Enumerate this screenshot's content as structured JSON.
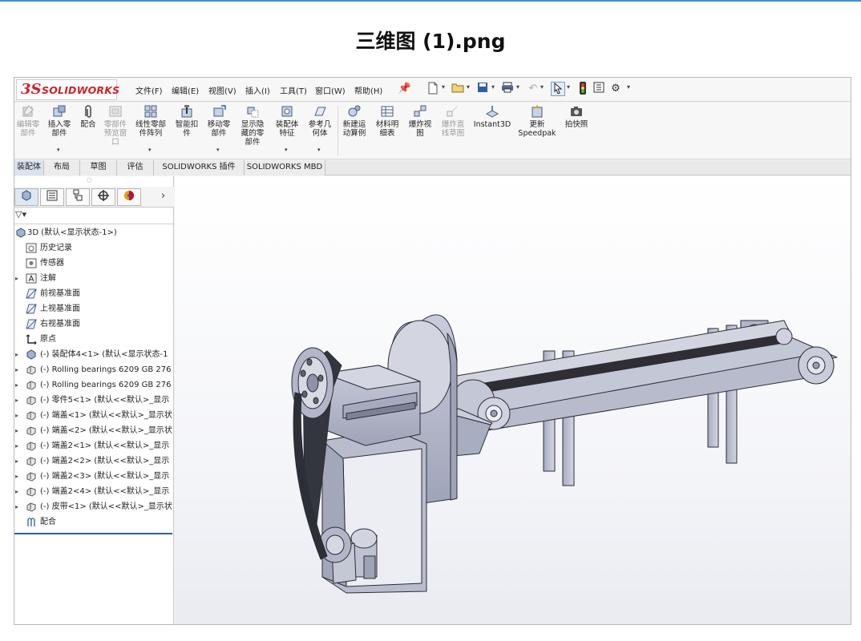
{
  "page": {
    "title": "三维图 (1).png"
  },
  "app": {
    "logo": {
      "mark": "3S",
      "text": "SOLIDWORKS"
    },
    "menu": [
      "文件(F)",
      "编辑(E)",
      "视图(V)",
      "插入(I)",
      "工具(T)",
      "窗口(W)",
      "帮助(H)"
    ],
    "quick_access_icons": [
      "pin-icon",
      "new-document-icon",
      "open-folder-icon",
      "save-icon",
      "print-icon",
      "undo-icon",
      "select-arrow-icon",
      "rebuild-traffic-light-icon",
      "file-properties-icon",
      "options-gear-icon"
    ]
  },
  "ribbon": {
    "edit_component": "编辑零\n部件",
    "insert_component": "插入零\n部件",
    "mate": "配合",
    "component_preview": "零部件\n预览窗\n口",
    "linear_pattern": "线性零部\n件阵列",
    "smart_fasteners": "智能扣\n件",
    "move_component": "移动零\n部件",
    "show_hidden": "显示隐\n藏的零\n部件",
    "assembly_features": "装配体\n特征",
    "reference_geometry": "参考几\n何体",
    "new_motion_study": "新建运\n动算例",
    "bill_of_materials": "材料明\n细表",
    "exploded_view": "爆炸视\n图",
    "explode_line": "爆炸直\n线草图",
    "instant3d": "Instant3D",
    "update_speedpak": "更新\nSpeedpak",
    "take_snapshot": "拍快照"
  },
  "tabs": [
    "装配体",
    "布局",
    "草图",
    "评估",
    "SOLIDWORKS 插件",
    "SOLIDWORKS MBD"
  ],
  "feature_tree": {
    "root": "3D  (默认<显示状态-1>)",
    "items": [
      {
        "label": "历史记录",
        "expandable": false,
        "icon": "history-icon"
      },
      {
        "label": "传感器",
        "expandable": false,
        "icon": "sensor-icon"
      },
      {
        "label": "注解",
        "expandable": true,
        "icon": "annotation-icon"
      },
      {
        "label": "前视基准面",
        "expandable": false,
        "icon": "plane-icon"
      },
      {
        "label": "上视基准面",
        "expandable": false,
        "icon": "plane-icon"
      },
      {
        "label": "右视基准面",
        "expandable": false,
        "icon": "plane-icon"
      },
      {
        "label": "原点",
        "expandable": false,
        "icon": "origin-icon"
      },
      {
        "label": "(-) 装配体4<1> (默认<显示状态-1",
        "expandable": true,
        "icon": "subassembly-icon"
      },
      {
        "label": "(-) Rolling bearings 6209 GB 276",
        "expandable": true,
        "icon": "part-icon"
      },
      {
        "label": "(-) Rolling bearings 6209 GB 276",
        "expandable": true,
        "icon": "part-icon"
      },
      {
        "label": "(-) 零件5<1> (默认<<默认>_显示",
        "expandable": true,
        "icon": "part-icon"
      },
      {
        "label": "(-) 端盖<1> (默认<<默认>_显示状",
        "expandable": true,
        "icon": "part-icon"
      },
      {
        "label": "(-) 端盖<2> (默认<<默认>_显示状",
        "expandable": true,
        "icon": "part-icon"
      },
      {
        "label": "(-) 端盖2<1> (默认<<默认>_显示",
        "expandable": true,
        "icon": "part-icon"
      },
      {
        "label": "(-) 端盖2<2> (默认<<默认>_显示",
        "expandable": true,
        "icon": "part-icon"
      },
      {
        "label": "(-) 端盖2<3> (默认<<默认>_显示",
        "expandable": true,
        "icon": "part-icon"
      },
      {
        "label": "(-) 端盖2<4> (默认<<默认>_显示",
        "expandable": true,
        "icon": "part-icon"
      },
      {
        "label": "(-) 皮带<1> (默认<<默认>_显示状",
        "expandable": true,
        "icon": "part-icon"
      },
      {
        "label": "配合",
        "expandable": false,
        "icon": "mates-icon"
      }
    ]
  },
  "viewport": {
    "toolbar_icons": [
      "zoom-to-fit-icon",
      "zoom-to-area-icon",
      "previous-view-icon",
      "section-view-icon",
      "view-orientation-icon",
      "display-style-icon",
      "hide-show-items-icon",
      "edit-appearance-icon",
      "apply-scene-icon",
      "view-settings-icon"
    ],
    "model": "conveyor-belt-assembly"
  },
  "colors": {
    "accent": "#2b5ea8",
    "logo": "#d0202a",
    "model": "#b9bccc",
    "belt": "#2a2a2a"
  }
}
